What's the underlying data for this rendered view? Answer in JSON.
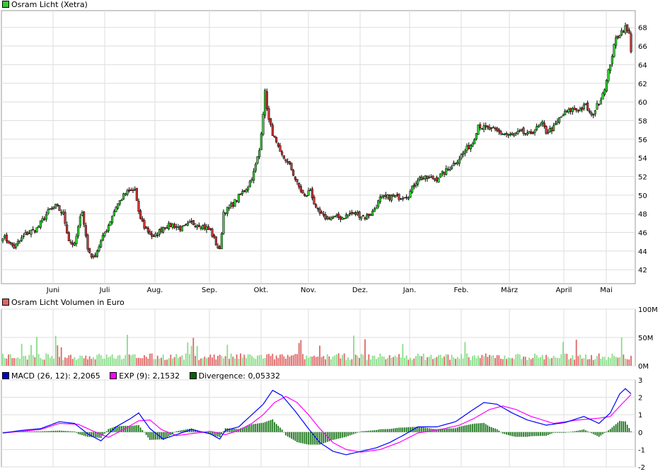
{
  "legend": {
    "price_label": "Osram Licht (Xetra)",
    "volume_label": "Osram Licht Volumen in Euro",
    "macd_label": "MACD (26, 12): 2,2065",
    "exp_label": "EXP (9): 2,1532",
    "div_label": "Divergence: 0,05332"
  },
  "colors": {
    "up": "#33cc33",
    "down": "#cc3333",
    "vol_up": "#88dd88",
    "vol_down": "#dd6666",
    "macd": "#0000ff",
    "exp": "#ff00ff",
    "divergence": "#006600",
    "grid": "#dddddd"
  },
  "chart_data": [
    {
      "type": "candlestick",
      "title": "Osram Licht (Xetra)",
      "x_tick_labels": [
        "Juni",
        "Juli",
        "Aug.",
        "Sep.",
        "Okt.",
        "Nov.",
        "Dez.",
        "Jan.",
        "Feb.",
        "März",
        "April",
        "Mai"
      ],
      "y_tick_labels": [
        "42",
        "44",
        "46",
        "48",
        "50",
        "52",
        "54",
        "56",
        "58",
        "60",
        "62",
        "64",
        "66",
        "68"
      ],
      "ylim": [
        40.5,
        69.8
      ],
      "grid": true,
      "close_anchors": [
        [
          0,
          45.6
        ],
        [
          6,
          44.4
        ],
        [
          12,
          45.8
        ],
        [
          18,
          46.4
        ],
        [
          24,
          48.2
        ],
        [
          28,
          48.8
        ],
        [
          32,
          48
        ],
        [
          35,
          45.2
        ],
        [
          38,
          44.6
        ],
        [
          42,
          48.4
        ],
        [
          45,
          44.2
        ],
        [
          48,
          43.2
        ],
        [
          52,
          45
        ],
        [
          56,
          46.8
        ],
        [
          60,
          48.8
        ],
        [
          65,
          50.2
        ],
        [
          70,
          50.6
        ],
        [
          72,
          48
        ],
        [
          75,
          46.6
        ],
        [
          80,
          45.4
        ],
        [
          85,
          46.6
        ],
        [
          90,
          46.8
        ],
        [
          95,
          46.4
        ],
        [
          100,
          47
        ],
        [
          105,
          46.8
        ],
        [
          110,
          46.2
        ],
        [
          113,
          44.8
        ],
        [
          115,
          44
        ],
        [
          117,
          48.2
        ],
        [
          120,
          48.6
        ],
        [
          125,
          49.8
        ],
        [
          130,
          51
        ],
        [
          133,
          52.4
        ],
        [
          136,
          54.8
        ],
        [
          139,
          61
        ],
        [
          141,
          58
        ],
        [
          144,
          56
        ],
        [
          147,
          54.4
        ],
        [
          150,
          53.8
        ],
        [
          153,
          52.8
        ],
        [
          156,
          51.2
        ],
        [
          160,
          49.8
        ],
        [
          163,
          50.6
        ],
        [
          166,
          48.4
        ],
        [
          170,
          47.6
        ],
        [
          175,
          47.6
        ],
        [
          180,
          47.6
        ],
        [
          184,
          48
        ],
        [
          188,
          48
        ],
        [
          192,
          47.6
        ],
        [
          196,
          48.2
        ],
        [
          200,
          49.6
        ],
        [
          205,
          49.8
        ],
        [
          210,
          49.8
        ],
        [
          215,
          50
        ],
        [
          220,
          51.8
        ],
        [
          225,
          51.8
        ],
        [
          230,
          51.8
        ],
        [
          235,
          52.6
        ],
        [
          238,
          53.2
        ],
        [
          242,
          54
        ],
        [
          246,
          55
        ],
        [
          249,
          55.6
        ],
        [
          252,
          57.6
        ],
        [
          255,
          57.2
        ],
        [
          260,
          57
        ],
        [
          265,
          56.6
        ],
        [
          270,
          56.4
        ],
        [
          275,
          56.8
        ],
        [
          278,
          56.4
        ],
        [
          282,
          57
        ],
        [
          286,
          57.6
        ],
        [
          288,
          56.8
        ],
        [
          292,
          57.2
        ],
        [
          295,
          58.2
        ],
        [
          298,
          58.8
        ],
        [
          302,
          59.2
        ],
        [
          306,
          59.2
        ],
        [
          309,
          59.6
        ],
        [
          312,
          58.4
        ],
        [
          314,
          59.2
        ],
        [
          317,
          60.4
        ],
        [
          320,
          62.2
        ],
        [
          322,
          64.2
        ],
        [
          325,
          66.8
        ],
        [
          328,
          67.6
        ],
        [
          330,
          68
        ],
        [
          332,
          67.2
        ],
        [
          333,
          65.6
        ]
      ],
      "volume_axis": [
        "100M",
        "50M",
        "0M"
      ],
      "macd_axis": [
        "3",
        "2",
        "1",
        "0",
        "-1",
        "-2"
      ],
      "macd_anchors": [
        [
          0,
          -0.05
        ],
        [
          10,
          0.1
        ],
        [
          20,
          0.2
        ],
        [
          30,
          0.6
        ],
        [
          38,
          0.5
        ],
        [
          45,
          -0.1
        ],
        [
          52,
          -0.5
        ],
        [
          60,
          0.3
        ],
        [
          68,
          0.8
        ],
        [
          72,
          1.1
        ],
        [
          78,
          0.2
        ],
        [
          85,
          -0.4
        ],
        [
          100,
          0.15
        ],
        [
          110,
          -0.1
        ],
        [
          115,
          -0.4
        ],
        [
          118,
          0.1
        ],
        [
          125,
          0.3
        ],
        [
          130,
          0.8
        ],
        [
          138,
          1.6
        ],
        [
          143,
          2.4
        ],
        [
          148,
          2.1
        ],
        [
          155,
          1.2
        ],
        [
          162,
          0.2
        ],
        [
          168,
          -0.6
        ],
        [
          175,
          -1.1
        ],
        [
          182,
          -1.3
        ],
        [
          190,
          -1.1
        ],
        [
          198,
          -0.9
        ],
        [
          205,
          -0.6
        ],
        [
          212,
          -0.2
        ],
        [
          220,
          0.3
        ],
        [
          230,
          0.3
        ],
        [
          240,
          0.6
        ],
        [
          248,
          1.2
        ],
        [
          255,
          1.7
        ],
        [
          262,
          1.6
        ],
        [
          270,
          1.1
        ],
        [
          278,
          0.7
        ],
        [
          288,
          0.4
        ],
        [
          298,
          0.55
        ],
        [
          308,
          0.9
        ],
        [
          316,
          0.5
        ],
        [
          322,
          1.1
        ],
        [
          327,
          2.2
        ],
        [
          330,
          2.5
        ],
        [
          333,
          2.2
        ]
      ],
      "exp_anchors": [
        [
          0,
          -0.05
        ],
        [
          10,
          0.05
        ],
        [
          20,
          0.15
        ],
        [
          30,
          0.5
        ],
        [
          40,
          0.45
        ],
        [
          48,
          0.05
        ],
        [
          56,
          -0.3
        ],
        [
          64,
          0.15
        ],
        [
          72,
          0.65
        ],
        [
          78,
          0.7
        ],
        [
          84,
          0.15
        ],
        [
          92,
          -0.2
        ],
        [
          110,
          0.05
        ],
        [
          118,
          -0.15
        ],
        [
          125,
          0.1
        ],
        [
          132,
          0.5
        ],
        [
          138,
          1.0
        ],
        [
          144,
          1.7
        ],
        [
          150,
          2.05
        ],
        [
          156,
          1.7
        ],
        [
          162,
          1.0
        ],
        [
          168,
          0.2
        ],
        [
          175,
          -0.6
        ],
        [
          182,
          -1.0
        ],
        [
          190,
          -1.15
        ],
        [
          200,
          -1.0
        ],
        [
          210,
          -0.6
        ],
        [
          220,
          -0.05
        ],
        [
          232,
          0.15
        ],
        [
          242,
          0.4
        ],
        [
          250,
          0.8
        ],
        [
          258,
          1.3
        ],
        [
          265,
          1.5
        ],
        [
          272,
          1.3
        ],
        [
          280,
          0.9
        ],
        [
          292,
          0.5
        ],
        [
          305,
          0.7
        ],
        [
          316,
          0.8
        ],
        [
          322,
          0.9
        ],
        [
          328,
          1.6
        ],
        [
          333,
          2.15
        ]
      ]
    }
  ]
}
